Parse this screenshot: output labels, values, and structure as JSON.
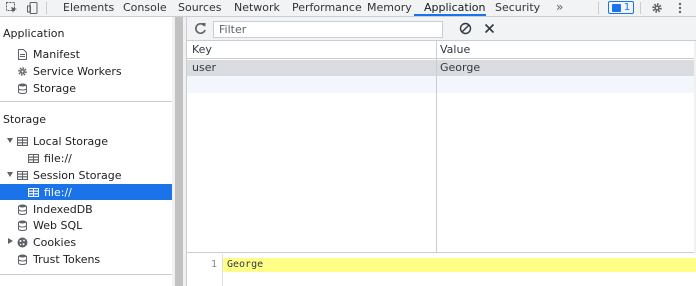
{
  "toolbar_tabs": [
    {
      "label": "Elements"
    },
    {
      "label": "Console"
    },
    {
      "label": "Sources"
    },
    {
      "label": "Network"
    },
    {
      "label": "Performance"
    },
    {
      "label": "Memory"
    },
    {
      "label": "Application"
    },
    {
      "label": "Security"
    }
  ],
  "active_tab": "Application",
  "more_tabs_glyph": "»",
  "issues_badge_count": "1",
  "icons": {
    "inspect": "inspect-element-icon",
    "device": "device-toolbar-icon",
    "more_tabs": "chevron-double-right-icon",
    "issues": "message-icon",
    "settings": "gear-icon",
    "menu": "kebab-menu-icon"
  },
  "sidebar": {
    "application_header": "Application",
    "application_items": [
      {
        "label": "Manifest",
        "icon": "document-icon"
      },
      {
        "label": "Service Workers",
        "icon": "gear-icon"
      },
      {
        "label": "Storage",
        "icon": "database-icon"
      }
    ],
    "storage_header": "Storage",
    "local_storage": {
      "label": "Local Storage",
      "child": "file://"
    },
    "session_storage": {
      "label": "Session Storage",
      "child": "file://"
    },
    "storage_items": [
      {
        "label": "IndexedDB",
        "icon": "database-icon"
      },
      {
        "label": "Web SQL",
        "icon": "database-icon"
      },
      {
        "label": "Cookies",
        "icon": "cookie-icon"
      },
      {
        "label": "Trust Tokens",
        "icon": "database-icon"
      }
    ]
  },
  "main": {
    "filter_placeholder": "Filter",
    "columns": {
      "key": "Key",
      "value": "Value"
    },
    "rows": [
      {
        "key": "user",
        "value": "George"
      }
    ],
    "preview": {
      "line_number": "1",
      "text": "George"
    }
  },
  "colors": {
    "accent": "#1a73e8",
    "selected_row": "#dadce0",
    "highlight": "#ffff88"
  }
}
